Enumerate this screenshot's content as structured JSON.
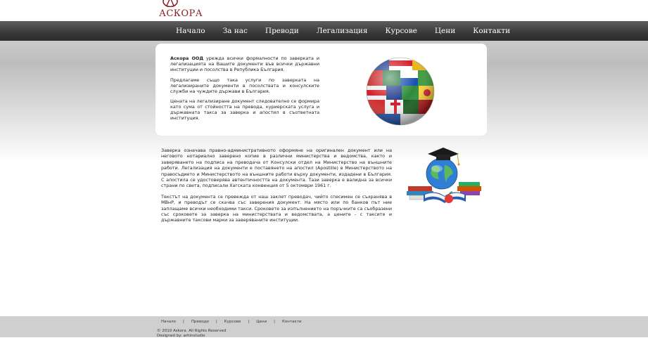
{
  "logo": {
    "text": "АСКОРА"
  },
  "nav": {
    "items": [
      "Начало",
      "За нас",
      "Преводи",
      "Легализация",
      "Курсове",
      "Цени",
      "Контакти"
    ]
  },
  "intro": {
    "company": "Аскора ООД",
    "p1_rest": " урежда всички формалности по заверката и легализацията на Вашите документи във всички държавни институции и посолства в Република България.",
    "p2": "Предлагаме също така услуги по заверката на легализираните документи в посолствата и консулските служби на чуждите държави в България.",
    "p3": "Цената на легализиране документ следователно се формира като сума от стойността на превода, куриерската услуга и държавната такса за заверка и апостил в съответната институция."
  },
  "content": {
    "p1": "Заверка означава правно-административното оформяне на оригинален документ или на неговото нотариално заверено копие в различни министерства и ведомства, както и заверяването на подписа на преводача от Консулски отдел на Министерство на външните работи. Легализация на документи е поставянето на апостил (Apostille) в Министерството на правосъдието и Министерството на външните работи върху документи, издадени в България. С апостила се удостоверява автентичността на документа. Тази заверка е валидна за всички страни по света, подписали Хагската конвенция от 5 октомври 1961 г.",
    "p2": "Текстът на документа се превежда от наш заклет преводач, чийто спесимен се съхранява в МВнР, и преводът се скачва със заверения документ. На място или по банков път ние заплащаме всички необходими такси. Сроковете за изпълнението на поръчките са съобразени със сроковете за заверка на министерствата и ведомствата, а цените - с таксите и държавните таксови марки за заверяваните институции."
  },
  "footer": {
    "links": [
      "Начало",
      "Преводи",
      "Курсове",
      "Цени",
      "Контакти"
    ],
    "separator": "|",
    "copyright": "© 2010 Askora. All Rights Reserved",
    "designed": "Designed by: arhinstudio"
  },
  "colors": {
    "logo": "#8b1a1a",
    "navbar": "#3b3b3b",
    "footer": "#cfcfcf"
  }
}
